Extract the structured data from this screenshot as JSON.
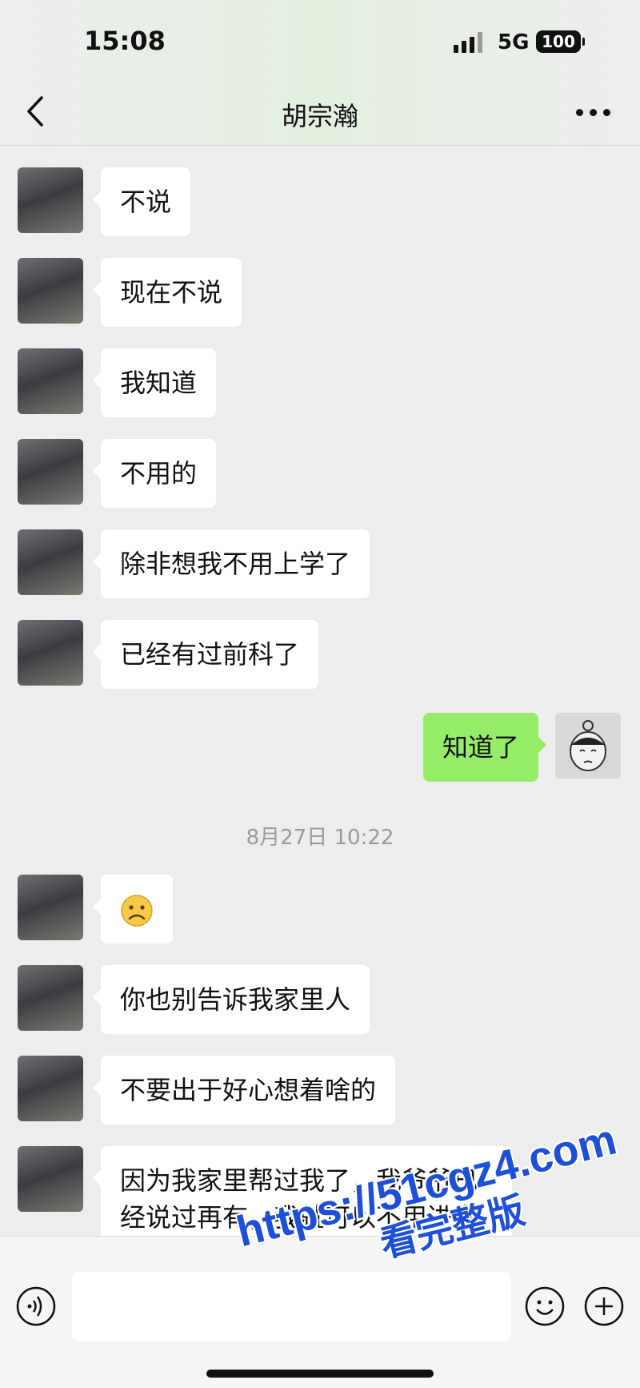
{
  "status_bar": {
    "time": "15:08",
    "network": "5G",
    "battery": "100"
  },
  "header": {
    "title": "胡宗瀚"
  },
  "messages": [
    {
      "side": "left",
      "text": "不说"
    },
    {
      "side": "left",
      "text": "现在不说"
    },
    {
      "side": "left",
      "text": "我知道"
    },
    {
      "side": "left",
      "text": "不用的"
    },
    {
      "side": "left",
      "text": "除非想我不用上学了"
    },
    {
      "side": "left",
      "text": "已经有过前科了"
    },
    {
      "side": "right",
      "text": "知道了"
    },
    {
      "type": "timestamp",
      "text": "8月27日 10:22"
    },
    {
      "side": "left",
      "text": "☹"
    },
    {
      "side": "left",
      "text": "你也别告诉我家里人"
    },
    {
      "side": "left",
      "text": "不要出于好心想着啥的"
    },
    {
      "side": "left",
      "text": "因为我家里帮过我了，我爷爷已经说过再有，我就可以不用进家"
    }
  ],
  "input_bar": {
    "value": ""
  },
  "watermark": {
    "url": "https://51cgz4.com",
    "caption": "看完整版"
  },
  "colors": {
    "sent_bubble": "#95ec69",
    "received_bubble": "#ffffff",
    "background": "#ededed",
    "watermark": "#1e4fd8"
  },
  "icons": [
    "back-arrow-icon",
    "more-icon",
    "voice-icon",
    "emoji-icon",
    "plus-icon",
    "signal-icon",
    "battery-icon"
  ]
}
